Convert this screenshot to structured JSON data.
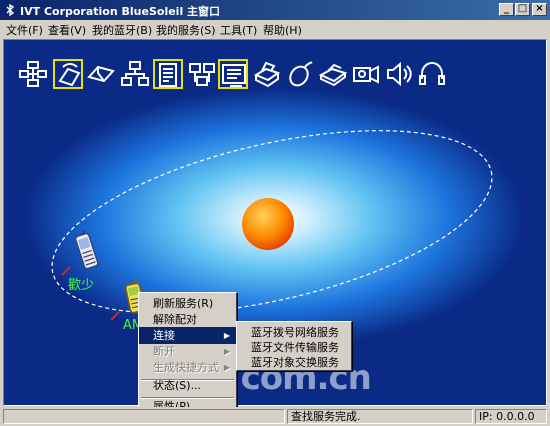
{
  "window": {
    "title": "IVT Corporation BlueSoleil 主窗口",
    "minimize_glyph": "_",
    "maximize_glyph": "□",
    "close_glyph": "×"
  },
  "menubar": [
    {
      "label": "文件(F)"
    },
    {
      "label": "查看(V)"
    },
    {
      "label": "我的蓝牙(B)"
    },
    {
      "label": "我的服务(S)"
    },
    {
      "label": "工具(T)"
    },
    {
      "label": "帮助(H)"
    }
  ],
  "service_icons": [
    {
      "name": "network-access-icon",
      "selected": false
    },
    {
      "name": "fax-phone-icon",
      "selected": true
    },
    {
      "name": "serial-port-icon",
      "selected": false
    },
    {
      "name": "lan-access-icon",
      "selected": false
    },
    {
      "name": "file-transfer-icon",
      "selected": true
    },
    {
      "name": "personal-network-icon",
      "selected": false
    },
    {
      "name": "object-push-icon",
      "selected": true
    },
    {
      "name": "printer-icon",
      "selected": false
    },
    {
      "name": "mouse-icon",
      "selected": false
    },
    {
      "name": "fax-icon",
      "selected": false
    },
    {
      "name": "camera-icon",
      "selected": false
    },
    {
      "name": "speaker-icon",
      "selected": false
    },
    {
      "name": "headset-icon",
      "selected": false
    }
  ],
  "devices": [
    {
      "label": "歡少",
      "icon": "mobile-phone-icon"
    },
    {
      "label": "AM",
      "icon": "mobile-phone-icon"
    }
  ],
  "context_menu": {
    "items": [
      {
        "label": "刷新服务(R)",
        "state": "normal"
      },
      {
        "label": "解除配对",
        "state": "normal"
      },
      {
        "label": "连接",
        "state": "highlighted",
        "submenu": true
      },
      {
        "label": "断开",
        "state": "disabled",
        "submenu": true
      },
      {
        "label": "生成快捷方式",
        "state": "disabled",
        "submenu": true
      },
      {
        "label": "状态(S)...",
        "state": "normal"
      },
      {
        "label": "属性(P)...",
        "state": "normal"
      }
    ]
  },
  "submenu": {
    "items": [
      {
        "label": "蓝牙拨号网络服务"
      },
      {
        "label": "蓝牙文件传输服务"
      },
      {
        "label": "蓝牙对象交换服务"
      }
    ]
  },
  "statusbar": {
    "message": "查找服务完成.",
    "ip": "IP: 0.0.0.0"
  },
  "watermark": "iT.com.cn",
  "colors": {
    "titlebar": "#0a246a",
    "highlight": "#0a246a",
    "device_label": "#3cff3c",
    "selected_icon_border": "#e8e000"
  }
}
